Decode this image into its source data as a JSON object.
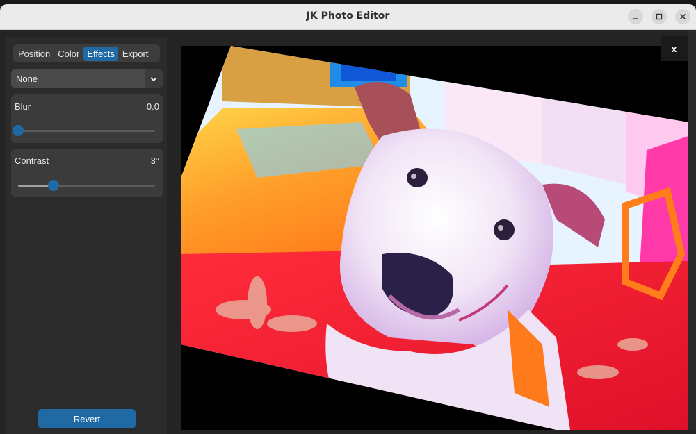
{
  "window": {
    "title": "JK Photo Editor"
  },
  "tabs": [
    {
      "label": "Position",
      "active": false
    },
    {
      "label": "Color",
      "active": false
    },
    {
      "label": "Effects",
      "active": true
    },
    {
      "label": "Export",
      "active": false
    }
  ],
  "filter_dropdown": {
    "selected": "None"
  },
  "blur": {
    "label": "Blur",
    "value_text": "0.0",
    "level": 0.0
  },
  "contrast": {
    "label": "Contrast",
    "value_text": "3°",
    "level": 0.26
  },
  "revert_button": {
    "label": "Revert"
  },
  "canvas": {
    "close_label": "x"
  },
  "colors": {
    "accent": "#1f6aa5",
    "panel_bg": "#2b2b2b",
    "card_bg": "#3b3b3b"
  }
}
